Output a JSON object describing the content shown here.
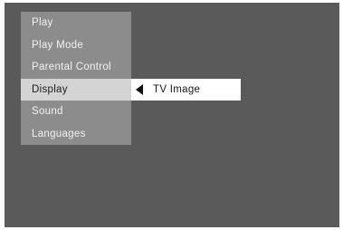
{
  "menu": {
    "items": [
      {
        "label": "Play"
      },
      {
        "label": "Play Mode"
      },
      {
        "label": "Parental Control"
      },
      {
        "label": "Display",
        "selected": true
      },
      {
        "label": "Sound"
      },
      {
        "label": "Languages"
      }
    ]
  },
  "submenu": {
    "icon": "left-triangle-arrow-icon",
    "label": "TV Image"
  },
  "colors": {
    "screen_background": "#5a5a5a",
    "menu_background": "#8c8c8c",
    "selected_item_background": "#d4d4d4",
    "submenu_background": "#ffffff"
  }
}
